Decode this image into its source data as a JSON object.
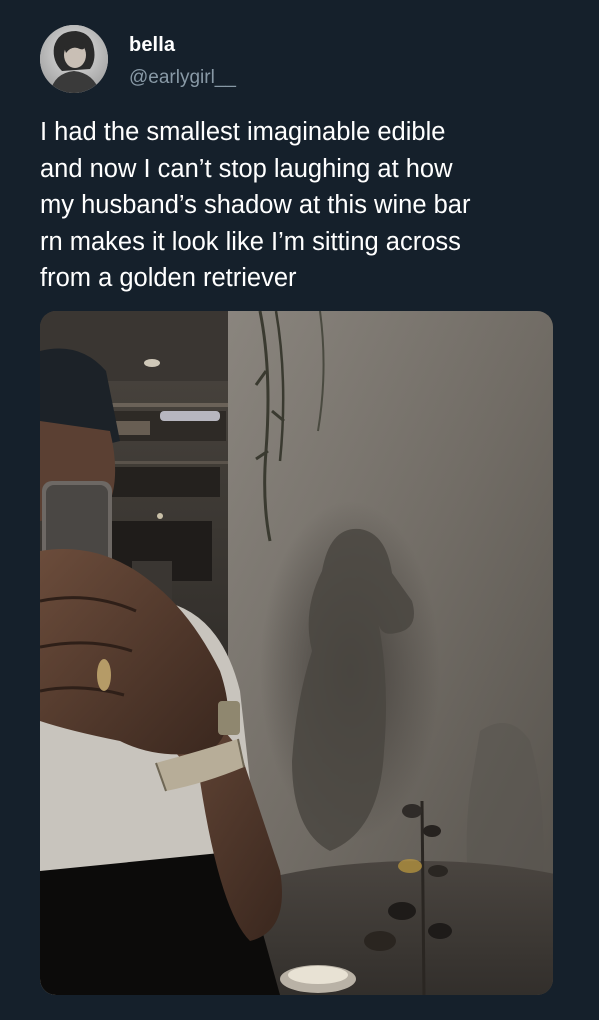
{
  "tweet": {
    "author": {
      "display_name": "bella",
      "handle": "@earlygirl__",
      "avatar_icon": "profile-photo-icon"
    },
    "text": "I had the smallest imaginable edible\nand now I can’t stop laughing at how\nmy husband’s shadow at this wine bar\nrn makes it look like I’m sitting across\nfrom a golden retriever",
    "media": {
      "kind": "photo"
    }
  },
  "colors": {
    "background": "#15202b",
    "text_primary": "#ffffff",
    "text_secondary": "#8899a6"
  }
}
